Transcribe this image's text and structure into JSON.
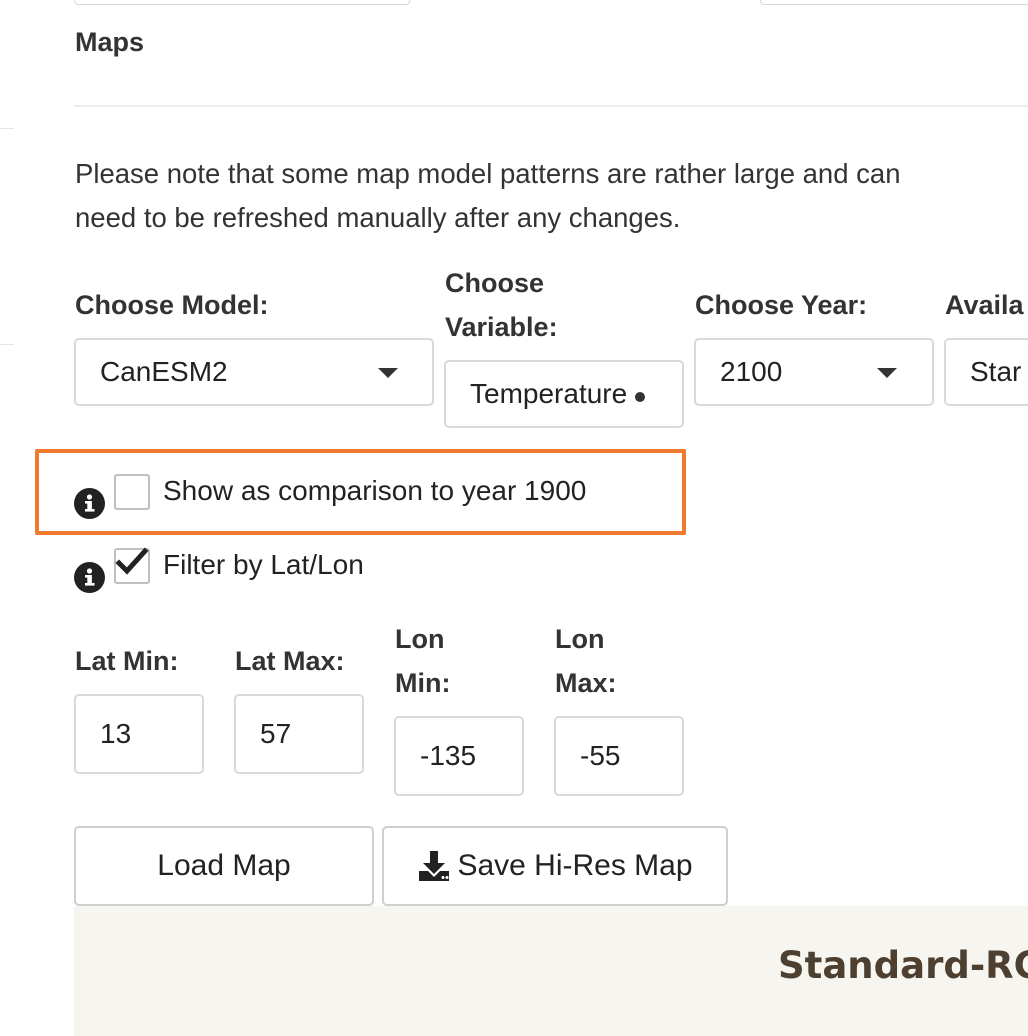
{
  "section": {
    "title": "Maps"
  },
  "note": {
    "line1": "Please note that some map model patterns are rather large and can",
    "line2": "need to be refreshed manually after any changes."
  },
  "controls": {
    "model": {
      "label": "Choose Model:",
      "value": "CanESM2"
    },
    "variable": {
      "label_line1": "Choose",
      "label_line2": "Variable:",
      "value": "Temperature"
    },
    "year": {
      "label": "Choose Year:",
      "value": "2100"
    },
    "available": {
      "label": "Availa",
      "value": "Star"
    }
  },
  "comparison": {
    "label": "Show as comparison to year 1900",
    "checked": false
  },
  "filter": {
    "label": "Filter by Lat/Lon",
    "checked": true
  },
  "bounds": {
    "lat_min": {
      "label": "Lat Min:",
      "value": "13"
    },
    "lat_max": {
      "label": "Lat Max:",
      "value": "57"
    },
    "lon_min": {
      "label_line1": "Lon",
      "label_line2": "Min:",
      "value": "-135"
    },
    "lon_max": {
      "label_line1": "Lon",
      "label_line2": "Max:",
      "value": "-55"
    }
  },
  "buttons": {
    "load_map": "Load Map",
    "save_map": "Save Hi-Res Map"
  },
  "map": {
    "title": "Standard-RC"
  },
  "colors": {
    "highlight": "#f07a30",
    "panel_bg": "#f7f5f0",
    "map_title": "#4d4031"
  }
}
